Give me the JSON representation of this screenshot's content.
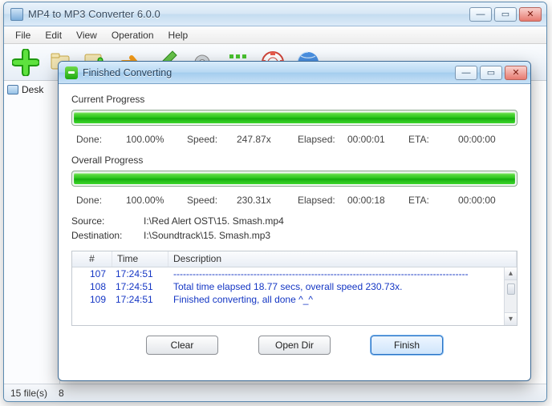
{
  "main_window": {
    "title": "MP4 to MP3 Converter 6.0.0",
    "buttons": {
      "min": "—",
      "max": "▭",
      "close": "✕"
    },
    "menu": [
      "File",
      "Edit",
      "View",
      "Operation",
      "Help"
    ],
    "sidebar_item": "Desk",
    "status": {
      "files": "15 file(s)",
      "extra": "8"
    }
  },
  "dialog": {
    "title": "Finished Converting",
    "buttons": {
      "min": "—",
      "max": "▭",
      "close": "✕"
    },
    "current": {
      "heading": "Current Progress",
      "done_label": "Done:",
      "done_value": "100.00%",
      "speed_label": "Speed:",
      "speed_value": "247.87x",
      "elapsed_label": "Elapsed:",
      "elapsed_value": "00:00:01",
      "eta_label": "ETA:",
      "eta_value": "00:00:00"
    },
    "overall": {
      "heading": "Overall Progress",
      "done_label": "Done:",
      "done_value": "100.00%",
      "speed_label": "Speed:",
      "speed_value": "230.31x",
      "elapsed_label": "Elapsed:",
      "elapsed_value": "00:00:18",
      "eta_label": "ETA:",
      "eta_value": "00:00:00"
    },
    "source_label": "Source:",
    "source_value": "I:\\Red Alert OST\\15. Smash.mp4",
    "dest_label": "Destination:",
    "dest_value": "I:\\Soundtrack\\15. Smash.mp3",
    "log": {
      "cols": {
        "num": "#",
        "time": "Time",
        "desc": "Description"
      },
      "rows": [
        {
          "num": "107",
          "time": "17:24:51",
          "desc": "--------------------------------------------------------------------------------------------"
        },
        {
          "num": "108",
          "time": "17:24:51",
          "desc": "Total time elapsed 18.77 secs, overall speed 230.73x."
        },
        {
          "num": "109",
          "time": "17:24:51",
          "desc": "Finished converting, all done ^_^"
        }
      ]
    },
    "actions": {
      "clear": "Clear",
      "open_dir": "Open Dir",
      "finish": "Finish"
    }
  }
}
